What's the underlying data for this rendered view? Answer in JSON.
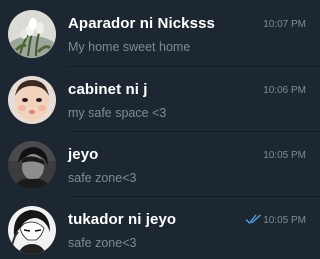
{
  "chats": [
    {
      "name": "Aparador ni Nicksss",
      "preview": "My home sweet home",
      "time": "10:07 PM",
      "avatar_icon": "tulips-photo"
    },
    {
      "name": "cabinet ni j",
      "preview": "my safe space <3",
      "time": "10:06 PM",
      "avatar_icon": "baby-face-photo"
    },
    {
      "name": "jeyo",
      "preview": "safe zone<3",
      "time": "10:05 PM",
      "avatar_icon": "dark-portrait-photo"
    },
    {
      "name": "tukador ni jeyo",
      "preview": "safe zone<3",
      "time": "10:05 PM",
      "avatar_icon": "anime-drawing-photo",
      "status_icon": "double-check-icon"
    }
  ],
  "colors": {
    "background": "#1d2732",
    "name_text": "#ffffff",
    "secondary_text": "#7d8b99",
    "read_check": "#5aa0e6"
  }
}
